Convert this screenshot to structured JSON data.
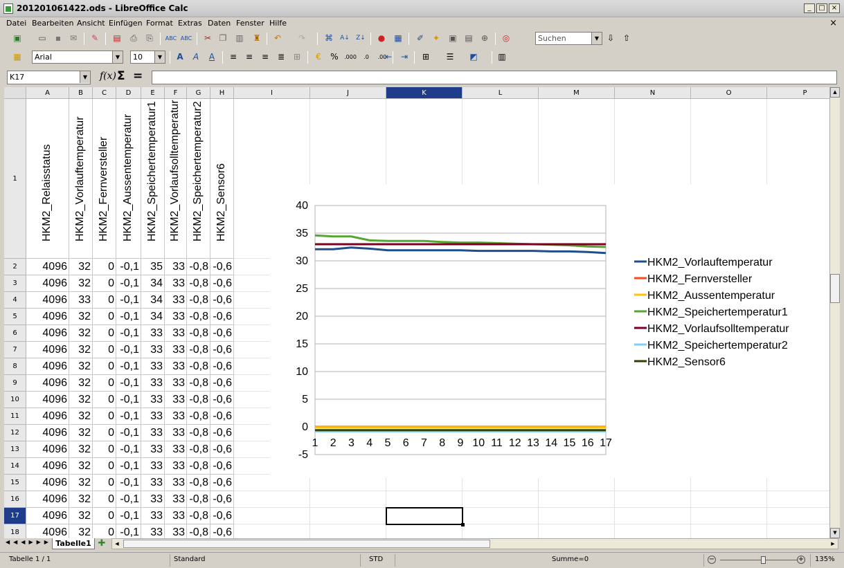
{
  "window": {
    "title": "201201061422.ods - LibreOffice Calc"
  },
  "menu": [
    "Datei",
    "Bearbeiten",
    "Ansicht",
    "Einfügen",
    "Format",
    "Extras",
    "Daten",
    "Fenster",
    "Hilfe"
  ],
  "toolbar": {
    "search_placeholder": "Suchen",
    "font_name": "Arial",
    "font_size": "10"
  },
  "formula": {
    "name_box": "K17",
    "content": ""
  },
  "columns": [
    "A",
    "B",
    "C",
    "D",
    "E",
    "F",
    "G",
    "H",
    "I",
    "J",
    "K",
    "L",
    "M",
    "N",
    "O",
    "P"
  ],
  "selected_column": "K",
  "selected_row": "17",
  "headers": [
    "HKM2_Relaisstatus",
    "HKM2_Vorlauftemperatur",
    "HKM2_Fernversteller",
    "HKM2_Aussentemperatur",
    "HKM2_Speichertemperatur1",
    "HKM2_Vorlaufsolltemperatur",
    "HKM2_Speichertemperatur2",
    "HKM2_Sensor6"
  ],
  "row_numbers": [
    "1",
    "2",
    "3",
    "4",
    "5",
    "6",
    "7",
    "8",
    "9",
    "10",
    "11",
    "12",
    "13",
    "14",
    "15",
    "16",
    "17",
    "18"
  ],
  "rows": [
    [
      "4096",
      "32",
      "0",
      "-0,1",
      "35",
      "33",
      "-0,8",
      "-0,6"
    ],
    [
      "4096",
      "32",
      "0",
      "-0,1",
      "34",
      "33",
      "-0,8",
      "-0,6"
    ],
    [
      "4096",
      "33",
      "0",
      "-0,1",
      "34",
      "33",
      "-0,8",
      "-0,6"
    ],
    [
      "4096",
      "32",
      "0",
      "-0,1",
      "34",
      "33",
      "-0,8",
      "-0,6"
    ],
    [
      "4096",
      "32",
      "0",
      "-0,1",
      "33",
      "33",
      "-0,8",
      "-0,6"
    ],
    [
      "4096",
      "32",
      "0",
      "-0,1",
      "33",
      "33",
      "-0,8",
      "-0,6"
    ],
    [
      "4096",
      "32",
      "0",
      "-0,1",
      "33",
      "33",
      "-0,8",
      "-0,6"
    ],
    [
      "4096",
      "32",
      "0",
      "-0,1",
      "33",
      "33",
      "-0,8",
      "-0,6"
    ],
    [
      "4096",
      "32",
      "0",
      "-0,1",
      "33",
      "33",
      "-0,8",
      "-0,6"
    ],
    [
      "4096",
      "32",
      "0",
      "-0,1",
      "33",
      "33",
      "-0,8",
      "-0,6"
    ],
    [
      "4096",
      "32",
      "0",
      "-0,1",
      "33",
      "33",
      "-0,8",
      "-0,6"
    ],
    [
      "4096",
      "32",
      "0",
      "-0,1",
      "33",
      "33",
      "-0,8",
      "-0,6"
    ],
    [
      "4096",
      "32",
      "0",
      "-0,1",
      "33",
      "33",
      "-0,8",
      "-0,6"
    ],
    [
      "4096",
      "32",
      "0",
      "-0,1",
      "33",
      "33",
      "-0,8",
      "-0,6"
    ],
    [
      "4096",
      "32",
      "0",
      "-0,1",
      "33",
      "33",
      "-0,8",
      "-0,6"
    ],
    [
      "4096",
      "32",
      "0",
      "-0,1",
      "33",
      "33",
      "-0,8",
      "-0,6"
    ],
    [
      "4096",
      "32",
      "0",
      "-0,1",
      "33",
      "33",
      "-0,8",
      "-0,6"
    ]
  ],
  "sheet_tab": "Tabelle1",
  "status": {
    "sheet": "Tabelle 1 / 1",
    "style": "Standard",
    "mode": "STD",
    "sum": "Summe=0",
    "zoom": "135%",
    "zoom_fraction": 0.55
  },
  "chart_data": {
    "type": "line",
    "x": [
      1,
      2,
      3,
      4,
      5,
      6,
      7,
      8,
      9,
      10,
      11,
      12,
      13,
      14,
      15,
      16,
      17
    ],
    "ylim": [
      -5,
      40
    ],
    "yticks": [
      -5,
      0,
      5,
      10,
      15,
      20,
      25,
      30,
      35,
      40
    ],
    "grid": true,
    "legend": "right",
    "series": [
      {
        "name": "HKM2_Vorlauftemperatur",
        "color": "#1f4e8c",
        "values": [
          32.1,
          32.1,
          32.4,
          32.2,
          31.9,
          31.9,
          31.9,
          31.9,
          31.9,
          31.8,
          31.8,
          31.8,
          31.8,
          31.7,
          31.7,
          31.6,
          31.4
        ]
      },
      {
        "name": "HKM2_Fernversteller",
        "color": "#ff4a1a",
        "values": [
          0,
          0,
          0,
          0,
          0,
          0,
          0,
          0,
          0,
          0,
          0,
          0,
          0,
          0,
          0,
          0,
          0
        ]
      },
      {
        "name": "HKM2_Aussentemperatur",
        "color": "#ffc20e",
        "values": [
          -0.1,
          -0.1,
          -0.1,
          -0.1,
          -0.1,
          -0.1,
          -0.1,
          -0.1,
          -0.1,
          -0.1,
          -0.1,
          -0.1,
          -0.1,
          -0.1,
          -0.1,
          -0.1,
          -0.1
        ]
      },
      {
        "name": "HKM2_Speichertemperatur1",
        "color": "#57a632",
        "values": [
          34.6,
          34.4,
          34.4,
          33.7,
          33.6,
          33.6,
          33.6,
          33.4,
          33.3,
          33.3,
          33.2,
          33.1,
          33.0,
          32.9,
          32.8,
          32.6,
          32.5
        ]
      },
      {
        "name": "HKM2_Vorlaufsolltemperatur",
        "color": "#7e0021",
        "values": [
          33,
          33,
          33,
          33,
          33,
          33,
          33,
          33,
          33,
          33,
          33,
          33,
          33,
          33,
          33,
          33,
          33
        ]
      },
      {
        "name": "HKM2_Speichertemperatur2",
        "color": "#83caff",
        "values": [
          -0.8,
          -0.8,
          -0.8,
          -0.8,
          -0.8,
          -0.8,
          -0.8,
          -0.8,
          -0.8,
          -0.8,
          -0.8,
          -0.8,
          -0.8,
          -0.8,
          -0.8,
          -0.8,
          -0.8
        ]
      },
      {
        "name": "HKM2_Sensor6",
        "color": "#314004",
        "values": [
          -0.6,
          -0.6,
          -0.6,
          -0.6,
          -0.6,
          -0.6,
          -0.6,
          -0.6,
          -0.6,
          -0.6,
          -0.6,
          -0.6,
          -0.6,
          -0.6,
          -0.6,
          -0.6,
          -0.6
        ]
      }
    ]
  }
}
